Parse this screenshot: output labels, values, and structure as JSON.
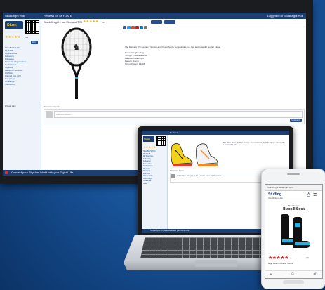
{
  "colors": {
    "brand_blue": "#1c3f73",
    "star": "#f0b400",
    "accent": "#1fb3e6"
  },
  "desktop": {
    "topbar_left": "SkuaBright Hub",
    "topbar_center": "Reviews for SKYGATE",
    "topbar_right": "Logged in to SkuaBright Hub",
    "logo_text": "Stuck",
    "sidebar_rating": "4.5",
    "sidebar_label": "Join",
    "sidebar_items": [
      "SkuaBright Hub",
      "My Stuff",
      "My Favorites",
      "Following",
      "Followers",
      "Favourite Organisation",
      "Notifications",
      "My Lists",
      "Favourite Stockists",
      "Wishlists",
      "Wanted Ads (3/3)",
      "Groupbuys",
      "Challenge",
      "Stats/Lists"
    ],
    "sidebar_footer": "Private Link",
    "product_title": "Black Knight - Ion Element TiSi",
    "product_rating": "4.5",
    "product_desc": "The Element TiSi merges Titanium and Power Surge technologies in a fast and powerful budget frame.",
    "product_specs": [
      "Frame Weight: 110g",
      "Strings: Professional 18",
      "Balance: Head Light",
      "Pattern: 14x18",
      "String Pattern: 14x18"
    ],
    "discussion_label": "Discussion Forum",
    "comment_placeholder": "Add a comment...",
    "comment_button": "Comment",
    "bottom_text": "Connect your Physical World with your Digital Life."
  },
  "laptop": {
    "topbar": "Reviews",
    "logo_text": "Stuck",
    "sidebar_items": [
      "SkuaBright Hub",
      "My Stuff",
      "My Favorites",
      "Following",
      "Followers",
      "Favourites",
      "Notifications",
      "My Lists",
      "Stockists",
      "Wishlists",
      "Wanted Ads",
      "Groupbuys",
      "Challenge",
      "Stats"
    ],
    "product_desc": "The Wave Rider 19 offers balance and comfort for the high-mileage runner with a responsive ride.",
    "discussion_label": "Discussion Forum",
    "comment_text": "I have been using these for 3 weeks and really love them.",
    "bottom_text": "Connect your Physical World with your Digital Life."
  },
  "phone": {
    "url": "StuckBright skuabright.com",
    "app_name": "Stuffing",
    "app_subtitle": "SkuaBright Hub",
    "brand": "BlackKnight",
    "product": "Black II Sock",
    "rating_count": "(3)",
    "footer_text": "High Reach Athletic Socks"
  }
}
